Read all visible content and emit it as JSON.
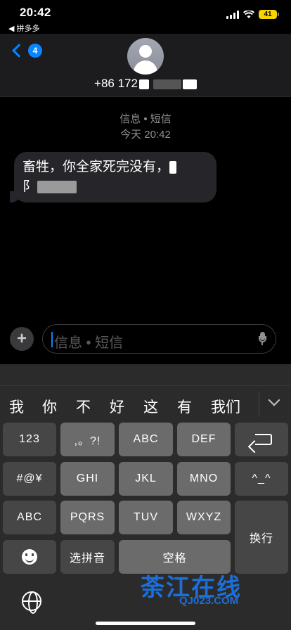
{
  "status_bar": {
    "time": "20:42",
    "back_app": "◀ 拼多多",
    "battery": "41"
  },
  "header": {
    "unread_count": "4",
    "contact_prefix": "+86 172"
  },
  "conversation": {
    "service_label": "信息 • 短信",
    "timestamp": "今天 20:42",
    "messages": [
      {
        "line1": "畜牲，你全家死完没有，",
        "line2": "阝"
      }
    ]
  },
  "compose": {
    "add_label": "+",
    "placeholder": "信息 • 短信"
  },
  "keyboard": {
    "candidates": [
      "我",
      "你",
      "不",
      "好",
      "这",
      "有",
      "我们"
    ],
    "keys": {
      "k123": "123",
      "punct": ",。?!",
      "abc": "ABC",
      "def": "DEF",
      "sym": "#@¥",
      "ghi": "GHI",
      "jkl": "JKL",
      "mno": "MNO",
      "face": "^_^",
      "abc_mode": "ABC",
      "pqrs": "PQRS",
      "tuv": "TUV",
      "wxyz": "WXYZ",
      "return": "换行",
      "pinyin": "选拼音",
      "space": "空格"
    }
  },
  "watermark": {
    "main": "荼江在线",
    "sub": "QJ023.COM"
  }
}
